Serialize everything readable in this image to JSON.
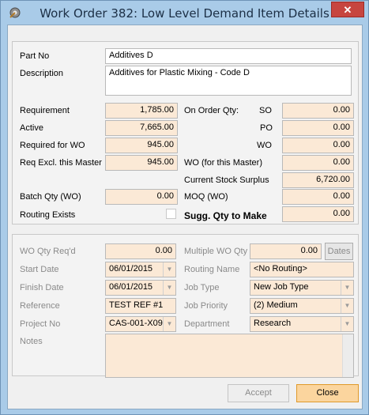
{
  "window": {
    "title": "Work Order 382: Low Level Demand Item Details",
    "close_glyph": "✕",
    "accent": "#c7453f"
  },
  "part": {
    "part_no_label": "Part No",
    "part_no": "Additives D",
    "description_label": "Description",
    "description": "Additives for Plastic Mixing - Code D"
  },
  "demand": {
    "requirement_label": "Requirement",
    "requirement": "1,785.00",
    "active_label": "Active",
    "active": "7,665.00",
    "required_for_wo_label": "Required for WO",
    "required_for_wo": "945.00",
    "req_excl_label": "Req Excl. this Master",
    "req_excl": "945.00",
    "batch_qty_label": "Batch Qty (WO)",
    "batch_qty": "0.00",
    "routing_exists_label": "Routing Exists",
    "routing_exists": false
  },
  "on_order": {
    "label": "On Order Qty:",
    "so_label": "SO",
    "so": "0.00",
    "po_label": "PO",
    "po": "0.00",
    "wo_label": "WO",
    "wo": "0.00",
    "wo_master_label": "WO (for this Master)",
    "wo_master": "0.00",
    "surplus_label": "Current Stock Surplus",
    "surplus": "6,720.00",
    "moq_label": "MOQ (WO)",
    "moq": "0.00",
    "sugg_label": "Sugg. Qty to Make",
    "sugg": "0.00"
  },
  "work_order": {
    "wo_qty_label": "WO Qty Req'd",
    "wo_qty": "0.00",
    "multiple_label": "Multiple WO Qty",
    "multiple": "0.00",
    "dates_button": "Dates",
    "start_label": "Start Date",
    "start": "06/01/2015",
    "finish_label": "Finish Date",
    "finish": "06/01/2015",
    "reference_label": "Reference",
    "reference": "TEST REF #1",
    "project_label": "Project No",
    "project": "CAS-001-X09",
    "routing_label": "Routing Name",
    "routing": "<No Routing>",
    "job_type_label": "Job Type",
    "job_type": "New Job Type",
    "priority_label": "Job Priority",
    "priority": "(2) Medium",
    "department_label": "Department",
    "department": "Research",
    "notes_label": "Notes",
    "notes": ""
  },
  "footer": {
    "accept": "Accept",
    "close": "Close"
  },
  "icons": {
    "dropdown": "▼",
    "app": "gear-icon"
  }
}
